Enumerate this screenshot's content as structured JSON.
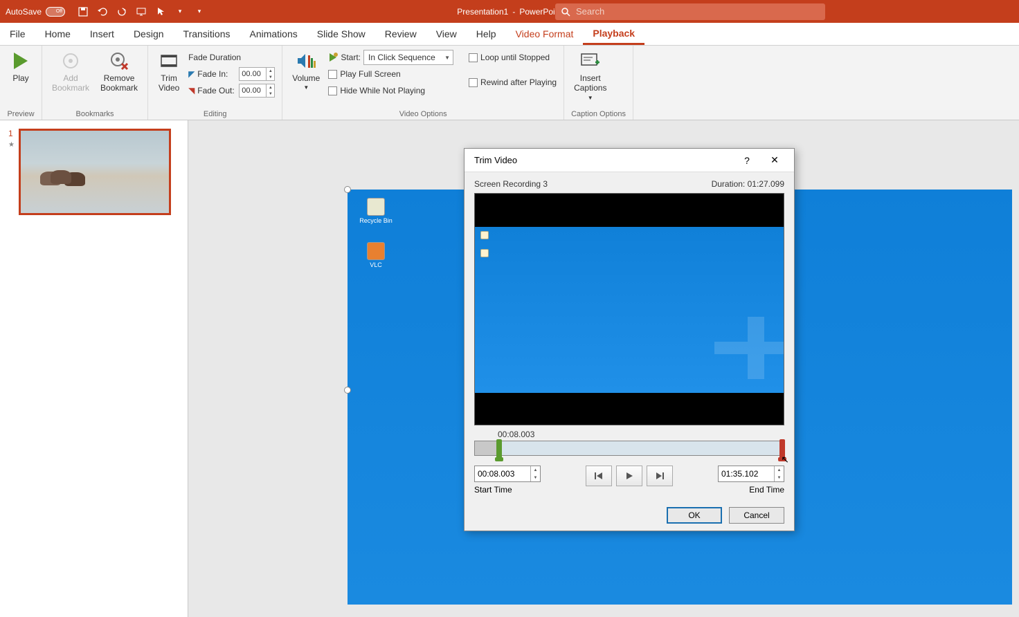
{
  "titlebar": {
    "autosave_label": "AutoSave",
    "autosave_off": "Off",
    "doc_name": "Presentation1",
    "sep": " - ",
    "app_name": "PowerPoint",
    "search_placeholder": "Search"
  },
  "tabs": {
    "file": "File",
    "home": "Home",
    "insert": "Insert",
    "design": "Design",
    "transitions": "Transitions",
    "animations": "Animations",
    "slideshow": "Slide Show",
    "review": "Review",
    "view": "View",
    "help": "Help",
    "video_format": "Video Format",
    "playback": "Playback"
  },
  "ribbon": {
    "preview": {
      "play": "Play",
      "group": "Preview"
    },
    "bookmarks": {
      "add": "Add\nBookmark",
      "remove": "Remove\nBookmark",
      "group": "Bookmarks"
    },
    "editing": {
      "trim": "Trim\nVideo",
      "fade_duration": "Fade Duration",
      "fade_in": "Fade In:",
      "fade_in_val": "00.00",
      "fade_out": "Fade Out:",
      "fade_out_val": "00.00",
      "group": "Editing"
    },
    "video_options": {
      "volume": "Volume",
      "start": "Start:",
      "start_val": "In Click Sequence",
      "play_full": "Play Full Screen",
      "hide": "Hide While Not Playing",
      "loop": "Loop until Stopped",
      "rewind": "Rewind after Playing",
      "group": "Video Options"
    },
    "captions": {
      "insert": "Insert\nCaptions",
      "group": "Caption Options"
    }
  },
  "slides": {
    "num1": "1"
  },
  "dialog": {
    "title": "Trim Video",
    "clip_name": "Screen Recording 3",
    "duration_label": "Duration: ",
    "duration_val": "01:27.099",
    "timecode": "00:08.003",
    "start_time_val": "00:08.003",
    "start_time_label": "Start Time",
    "end_time_val": "01:35.102",
    "end_time_label": "End Time",
    "ok": "OK",
    "cancel": "Cancel",
    "help": "?",
    "close": "✕"
  },
  "desktop_icons": {
    "recycle": "Recycle Bin",
    "vlc": "VLC"
  }
}
